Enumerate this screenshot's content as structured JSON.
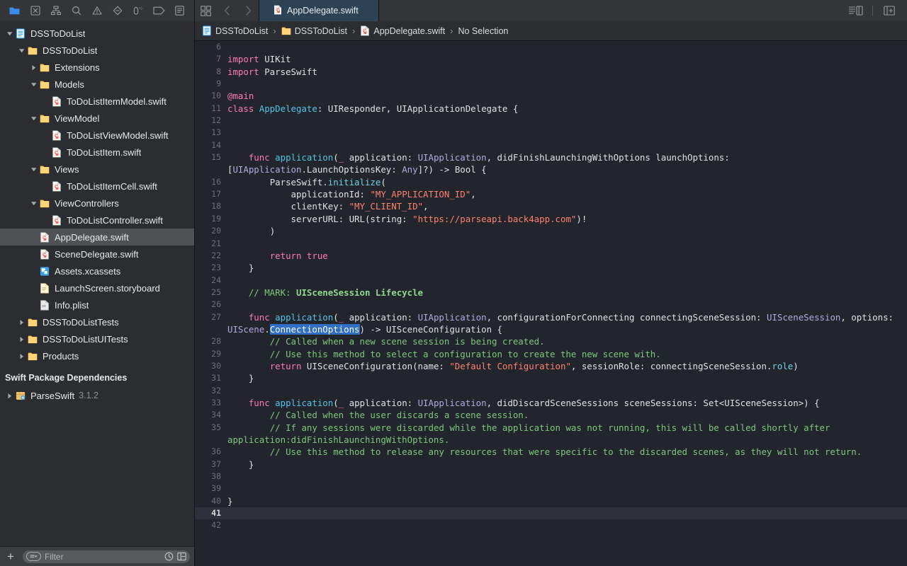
{
  "window": {
    "title": "DSSToDoList — AppDelegate.swift"
  },
  "toolbar": {
    "navigator_icons": [
      {
        "name": "folder-icon",
        "label": "Project navigator",
        "active": true
      },
      {
        "name": "source-control-icon",
        "label": "Source control navigator",
        "active": false
      },
      {
        "name": "hierarchy-icon",
        "label": "Symbol navigator",
        "active": false
      },
      {
        "name": "search-icon",
        "label": "Find navigator",
        "active": false
      },
      {
        "name": "warning-icon",
        "label": "Issue navigator",
        "active": false
      },
      {
        "name": "diamond-icon",
        "label": "Test navigator",
        "active": false
      },
      {
        "name": "debug-icon",
        "label": "Debug navigator",
        "active": false
      },
      {
        "name": "tag-icon",
        "label": "Breakpoint navigator",
        "active": false
      },
      {
        "name": "report-icon",
        "label": "Report navigator",
        "active": false
      }
    ],
    "grid_button": "Show tab overview",
    "back_button": "Go back",
    "forward_button": "Go forward",
    "inspector_button": "Hide or show the Inspectors",
    "add_editor_button": "Add editor"
  },
  "tabs": [
    {
      "label": "AppDelegate.swift",
      "icon": "swift-file-icon",
      "active": true
    }
  ],
  "breadcrumb": {
    "items": [
      {
        "label": "DSSToDoList",
        "icon": "project-icon"
      },
      {
        "label": "DSSToDoList",
        "icon": "folder-icon"
      },
      {
        "label": "AppDelegate.swift",
        "icon": "swift-file-icon"
      },
      {
        "label": "No Selection",
        "icon": "none"
      }
    ],
    "separator": "›"
  },
  "sidebar": {
    "filter": {
      "placeholder": "Filter",
      "add_label": "+",
      "recent_icon": "clock-icon",
      "nested_icon": "nested-icon"
    },
    "sections": [
      {
        "title": null,
        "items": [
          {
            "label": "DSSToDoList",
            "icon": "project-icon",
            "depth": 0,
            "twisty": "down",
            "selected": false
          },
          {
            "label": "DSSToDoList",
            "icon": "folder-icon",
            "depth": 1,
            "twisty": "down",
            "selected": false
          },
          {
            "label": "Extensions",
            "icon": "folder-icon",
            "depth": 2,
            "twisty": "right",
            "selected": false
          },
          {
            "label": "Models",
            "icon": "folder-icon",
            "depth": 2,
            "twisty": "down",
            "selected": false
          },
          {
            "label": "ToDoListItemModel.swift",
            "icon": "swift-file-icon",
            "depth": 3,
            "twisty": "none",
            "selected": false
          },
          {
            "label": "ViewModel",
            "icon": "folder-icon",
            "depth": 2,
            "twisty": "down",
            "selected": false
          },
          {
            "label": "ToDoListViewModel.swift",
            "icon": "swift-file-icon",
            "depth": 3,
            "twisty": "none",
            "selected": false
          },
          {
            "label": "ToDoListItem.swift",
            "icon": "swift-file-icon",
            "depth": 3,
            "twisty": "none",
            "selected": false
          },
          {
            "label": "Views",
            "icon": "folder-icon",
            "depth": 2,
            "twisty": "down",
            "selected": false
          },
          {
            "label": "ToDoListItemCell.swift",
            "icon": "swift-file-icon",
            "depth": 3,
            "twisty": "none",
            "selected": false
          },
          {
            "label": "ViewControllers",
            "icon": "folder-icon",
            "depth": 2,
            "twisty": "down",
            "selected": false
          },
          {
            "label": "ToDoListController.swift",
            "icon": "swift-file-icon",
            "depth": 3,
            "twisty": "none",
            "selected": false
          },
          {
            "label": "AppDelegate.swift",
            "icon": "swift-file-icon",
            "depth": 2,
            "twisty": "none",
            "selected": true
          },
          {
            "label": "SceneDelegate.swift",
            "icon": "swift-file-icon",
            "depth": 2,
            "twisty": "none",
            "selected": false
          },
          {
            "label": "Assets.xcassets",
            "icon": "assets-icon",
            "depth": 2,
            "twisty": "none",
            "selected": false
          },
          {
            "label": "LaunchScreen.storyboard",
            "icon": "storyboard-icon",
            "depth": 2,
            "twisty": "none",
            "selected": false
          },
          {
            "label": "Info.plist",
            "icon": "plist-icon",
            "depth": 2,
            "twisty": "none",
            "selected": false
          },
          {
            "label": "DSSToDoListTests",
            "icon": "folder-icon",
            "depth": 1,
            "twisty": "right",
            "selected": false
          },
          {
            "label": "DSSToDoListUITests",
            "icon": "folder-icon",
            "depth": 1,
            "twisty": "right",
            "selected": false
          },
          {
            "label": "Products",
            "icon": "folder-icon",
            "depth": 1,
            "twisty": "right",
            "selected": false
          }
        ]
      },
      {
        "title": "Swift Package Dependencies",
        "items": [
          {
            "label": "ParseSwift",
            "version": "3.1.2",
            "icon": "package-icon",
            "depth": 0,
            "twisty": "right",
            "selected": false
          }
        ]
      }
    ]
  },
  "editor": {
    "current_line": 41,
    "lines": [
      {
        "n": 6,
        "tokens": []
      },
      {
        "n": 7,
        "tokens": [
          {
            "t": "import ",
            "c": "k"
          },
          {
            "t": "UIKit",
            "c": "pl"
          }
        ]
      },
      {
        "n": 8,
        "tokens": [
          {
            "t": "import ",
            "c": "k"
          },
          {
            "t": "ParseSwift",
            "c": "pl"
          }
        ]
      },
      {
        "n": 9,
        "tokens": []
      },
      {
        "n": 10,
        "tokens": [
          {
            "t": "@main",
            "c": "at"
          }
        ]
      },
      {
        "n": 11,
        "tokens": [
          {
            "t": "class ",
            "c": "k"
          },
          {
            "t": "AppDelegate",
            "c": "fn"
          },
          {
            "t": ": UIResponder, UIApplicationDelegate {",
            "c": "pl"
          }
        ]
      },
      {
        "n": 12,
        "tokens": []
      },
      {
        "n": 13,
        "tokens": []
      },
      {
        "n": 14,
        "tokens": []
      },
      {
        "n": 15,
        "tokens": [
          {
            "t": "    ",
            "c": "pl"
          },
          {
            "t": "func ",
            "c": "k"
          },
          {
            "t": "application",
            "c": "fn"
          },
          {
            "t": "(",
            "c": "pl"
          },
          {
            "t": "_",
            "c": "k"
          },
          {
            "t": " application: ",
            "c": "pl"
          },
          {
            "t": "UIApplication",
            "c": "ty"
          },
          {
            "t": ", didFinishLaunchingWithOptions launchOptions: [",
            "c": "pl"
          },
          {
            "t": "UIApplication",
            "c": "ty"
          },
          {
            "t": ".LaunchOptionsKey: ",
            "c": "pl"
          },
          {
            "t": "Any",
            "c": "ty"
          },
          {
            "t": "]?) -> ",
            "c": "pl"
          },
          {
            "t": "Bool",
            "c": "pl"
          },
          {
            "t": " {",
            "c": "pl"
          }
        ]
      },
      {
        "n": 16,
        "tokens": [
          {
            "t": "        ParseSwift.",
            "c": "pl"
          },
          {
            "t": "initialize",
            "c": "mb"
          },
          {
            "t": "(",
            "c": "pl"
          }
        ]
      },
      {
        "n": 17,
        "tokens": [
          {
            "t": "            applicationId: ",
            "c": "pl"
          },
          {
            "t": "\"MY_APPLICATION_ID\"",
            "c": "st"
          },
          {
            "t": ",",
            "c": "pl"
          }
        ]
      },
      {
        "n": 18,
        "tokens": [
          {
            "t": "            clientKey: ",
            "c": "pl"
          },
          {
            "t": "\"MY_CLIENT_ID\"",
            "c": "st"
          },
          {
            "t": ",",
            "c": "pl"
          }
        ]
      },
      {
        "n": 19,
        "tokens": [
          {
            "t": "            serverURL: URL(string: ",
            "c": "pl"
          },
          {
            "t": "\"https://parseapi.back4app.com\"",
            "c": "st"
          },
          {
            "t": ")!",
            "c": "pl"
          }
        ]
      },
      {
        "n": 20,
        "tokens": [
          {
            "t": "        )",
            "c": "pl"
          }
        ]
      },
      {
        "n": 21,
        "tokens": []
      },
      {
        "n": 22,
        "tokens": [
          {
            "t": "        ",
            "c": "pl"
          },
          {
            "t": "return ",
            "c": "k"
          },
          {
            "t": "true",
            "c": "k"
          }
        ]
      },
      {
        "n": 23,
        "tokens": [
          {
            "t": "    }",
            "c": "pl"
          }
        ]
      },
      {
        "n": 24,
        "tokens": []
      },
      {
        "n": 25,
        "tokens": [
          {
            "t": "    ",
            "c": "pl"
          },
          {
            "t": "// MARK: ",
            "c": "cm"
          },
          {
            "t": "UISceneSession Lifecycle",
            "c": "cmb"
          }
        ]
      },
      {
        "n": 26,
        "tokens": []
      },
      {
        "n": 27,
        "tokens": [
          {
            "t": "    ",
            "c": "pl"
          },
          {
            "t": "func ",
            "c": "k"
          },
          {
            "t": "application",
            "c": "fn"
          },
          {
            "t": "(",
            "c": "pl"
          },
          {
            "t": "_",
            "c": "k"
          },
          {
            "t": " application: ",
            "c": "pl"
          },
          {
            "t": "UIApplication",
            "c": "ty"
          },
          {
            "t": ", configurationForConnecting connectingSceneSession: ",
            "c": "pl"
          },
          {
            "t": "UISceneSession",
            "c": "ty"
          },
          {
            "t": ", options: ",
            "c": "pl"
          },
          {
            "t": "UIScene",
            "c": "ty"
          },
          {
            "t": ".",
            "c": "pl"
          },
          {
            "t": "ConnectionOptions",
            "c": "sel"
          },
          {
            "t": ") -> ",
            "c": "pl"
          },
          {
            "t": "UISceneConfiguration",
            "c": "pl"
          },
          {
            "t": " {",
            "c": "pl"
          }
        ]
      },
      {
        "n": 28,
        "tokens": [
          {
            "t": "        ",
            "c": "pl"
          },
          {
            "t": "// Called when a new scene session is being created.",
            "c": "cm"
          }
        ]
      },
      {
        "n": 29,
        "tokens": [
          {
            "t": "        ",
            "c": "pl"
          },
          {
            "t": "// Use this method to select a configuration to create the new scene with.",
            "c": "cm"
          }
        ]
      },
      {
        "n": 30,
        "tokens": [
          {
            "t": "        ",
            "c": "pl"
          },
          {
            "t": "return ",
            "c": "k"
          },
          {
            "t": "UISceneConfiguration(name: ",
            "c": "pl"
          },
          {
            "t": "\"Default Configuration\"",
            "c": "st"
          },
          {
            "t": ", sessionRole: connectingSceneSession.",
            "c": "pl"
          },
          {
            "t": "role",
            "c": "mb"
          },
          {
            "t": ")",
            "c": "pl"
          }
        ]
      },
      {
        "n": 31,
        "tokens": [
          {
            "t": "    }",
            "c": "pl"
          }
        ]
      },
      {
        "n": 32,
        "tokens": []
      },
      {
        "n": 33,
        "tokens": [
          {
            "t": "    ",
            "c": "pl"
          },
          {
            "t": "func ",
            "c": "k"
          },
          {
            "t": "application",
            "c": "fn"
          },
          {
            "t": "(",
            "c": "pl"
          },
          {
            "t": "_",
            "c": "k"
          },
          {
            "t": " application: ",
            "c": "pl"
          },
          {
            "t": "UIApplication",
            "c": "ty"
          },
          {
            "t": ", didDiscardSceneSessions sceneSessions: Set<",
            "c": "pl"
          },
          {
            "t": "UISceneSession",
            "c": "pl"
          },
          {
            "t": ">) {",
            "c": "pl"
          }
        ]
      },
      {
        "n": 34,
        "tokens": [
          {
            "t": "        ",
            "c": "pl"
          },
          {
            "t": "// Called when the user discards a scene session.",
            "c": "cm"
          }
        ]
      },
      {
        "n": 35,
        "tokens": [
          {
            "t": "        ",
            "c": "pl"
          },
          {
            "t": "// If any sessions were discarded while the application was not running, this will be called shortly after application:didFinishLaunchingWithOptions.",
            "c": "cm"
          }
        ]
      },
      {
        "n": 36,
        "tokens": [
          {
            "t": "        ",
            "c": "pl"
          },
          {
            "t": "// Use this method to release any resources that were specific to the discarded scenes, as they will not return.",
            "c": "cm"
          }
        ]
      },
      {
        "n": 37,
        "tokens": [
          {
            "t": "    }",
            "c": "pl"
          }
        ]
      },
      {
        "n": 38,
        "tokens": []
      },
      {
        "n": 39,
        "tokens": []
      },
      {
        "n": 40,
        "tokens": [
          {
            "t": "}",
            "c": "pl"
          }
        ]
      },
      {
        "n": 41,
        "tokens": []
      },
      {
        "n": 42,
        "tokens": []
      }
    ]
  },
  "colors": {
    "editor_bg": "#22252b",
    "sidebar_bg": "#2b2d30",
    "chrome_bg": "#333538",
    "tab_active_bg": "#2e4256",
    "selection_blue": "#2f6fc4",
    "accent_blue": "#3b8ae8",
    "keyword_pink": "#ff7ab2",
    "string_salmon": "#ff8170",
    "comment_green": "#7fc77f",
    "type_purple": "#b5a9e4",
    "func_blue": "#57c2e8"
  }
}
